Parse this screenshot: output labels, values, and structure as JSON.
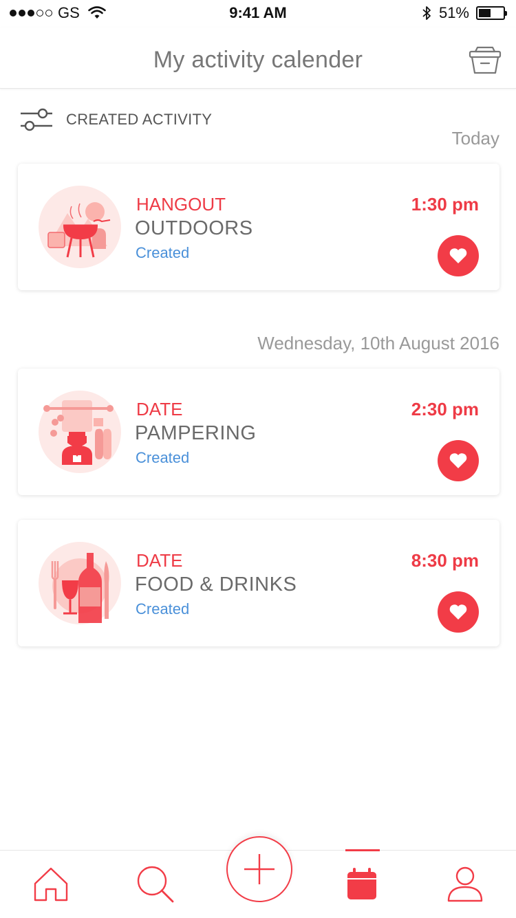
{
  "status_bar": {
    "carrier": "GS",
    "time": "9:41 AM",
    "battery_percent": "51%",
    "battery_level": 0.51,
    "signal_bars_filled": 3,
    "signal_bars_total": 5
  },
  "header": {
    "title": "My activity calender",
    "basket_icon": "basket-icon"
  },
  "filter": {
    "label": "CREATED ACTIVITY",
    "icon": "sliders-icon"
  },
  "groups": [
    {
      "date_label": "Today",
      "activities": [
        {
          "category": "HANGOUT",
          "name": "OUTDOORS",
          "status": "Created",
          "time": "1:30 pm",
          "icon": "outdoors-bbq-icon"
        }
      ]
    },
    {
      "date_label": "Wednesday, 10th August 2016",
      "activities": [
        {
          "category": "DATE",
          "name": "PAMPERING",
          "status": "Created",
          "time": "2:30 pm",
          "icon": "pampering-spa-icon"
        },
        {
          "category": "DATE",
          "name": "FOOD & DRINKS",
          "status": "Created",
          "time": "8:30 pm",
          "icon": "food-drinks-icon"
        }
      ]
    }
  ],
  "bottom_nav": {
    "items": [
      "home-icon",
      "search-icon",
      "add-icon",
      "calendar-icon",
      "profile-icon"
    ],
    "active": "calendar-icon"
  },
  "colors": {
    "accent": "#f23c47",
    "status_blue": "#4a90d9",
    "title_gray": "#777777"
  }
}
